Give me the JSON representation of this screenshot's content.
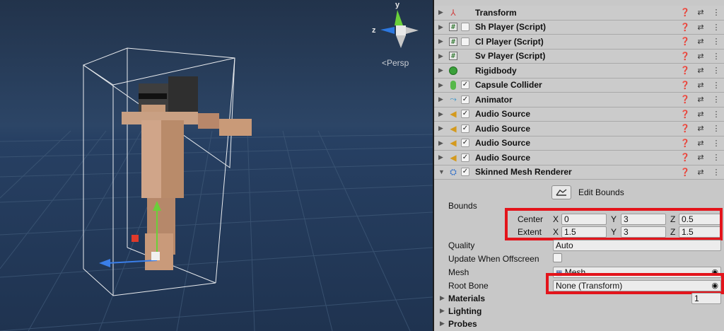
{
  "scene": {
    "view_label": "<Persp",
    "gizmo": {
      "y": "y",
      "z": "z"
    }
  },
  "components": [
    {
      "name": "Transform",
      "icon": "transform-icon",
      "checkbox": "none"
    },
    {
      "name": "Sh Player (Script)",
      "icon": "script-icon",
      "checkbox": "unchecked"
    },
    {
      "name": "Cl Player (Script)",
      "icon": "script-icon",
      "checkbox": "unchecked"
    },
    {
      "name": "Sv Player (Script)",
      "icon": "script-icon",
      "checkbox": "none"
    },
    {
      "name": "Rigidbody",
      "icon": "rigidbody-icon",
      "checkbox": "none"
    },
    {
      "name": "Capsule Collider",
      "icon": "capsule-collider-icon",
      "checkbox": "checked"
    },
    {
      "name": "Animator",
      "icon": "animator-icon",
      "checkbox": "checked"
    },
    {
      "name": "Audio Source",
      "icon": "audio-source-icon",
      "checkbox": "checked"
    },
    {
      "name": "Audio Source",
      "icon": "audio-source-icon",
      "checkbox": "checked"
    },
    {
      "name": "Audio Source",
      "icon": "audio-source-icon",
      "checkbox": "checked"
    },
    {
      "name": "Audio Source",
      "icon": "audio-source-icon",
      "checkbox": "checked"
    },
    {
      "name": "Skinned Mesh Renderer",
      "icon": "skinned-mesh-icon",
      "checkbox": "checked"
    }
  ],
  "renderer": {
    "edit_bounds": "Edit Bounds",
    "bounds_label": "Bounds",
    "center": {
      "label": "Center",
      "x": "0",
      "y": "3",
      "z": "0.5"
    },
    "extent": {
      "label": "Extent",
      "x": "1.5",
      "y": "3",
      "z": "1.5"
    },
    "axis": {
      "x": "X",
      "y": "Y",
      "z": "Z"
    },
    "quality": {
      "label": "Quality",
      "value": "Auto"
    },
    "update_offscreen": {
      "label": "Update When Offscreen"
    },
    "mesh": {
      "label": "Mesh",
      "value": "Mesh"
    },
    "root_bone": {
      "label": "Root Bone",
      "value": "None (Transform)"
    },
    "materials": {
      "label": "Materials",
      "count": "1"
    },
    "lighting": "Lighting",
    "probes": "Probes"
  },
  "colors": {
    "highlight": "#e3141b",
    "scene_bg": "#243650",
    "inspector_bg": "#c8c8c8"
  }
}
